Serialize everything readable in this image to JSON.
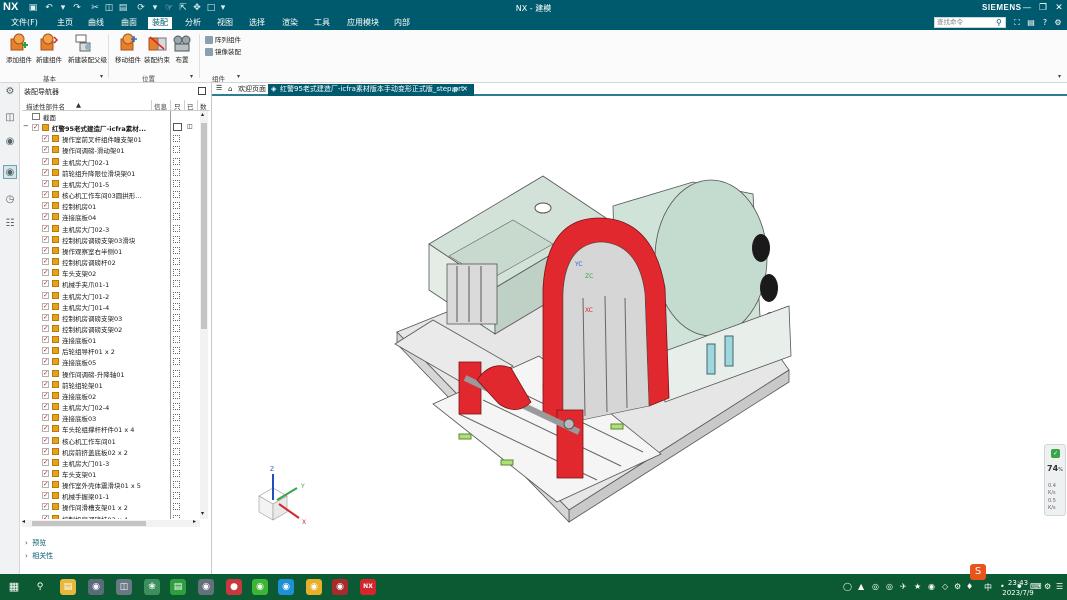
{
  "window": {
    "logo": "NX",
    "title": "NX - 建模",
    "brand": "SIEMENS"
  },
  "menu": {
    "items": [
      {
        "label": "文件(F)"
      },
      {
        "label": "主页"
      },
      {
        "label": "曲线"
      },
      {
        "label": "曲面"
      },
      {
        "label": "装配"
      },
      {
        "label": "分析"
      },
      {
        "label": "视图"
      },
      {
        "label": "选择"
      },
      {
        "label": "渲染"
      },
      {
        "label": "工具"
      },
      {
        "label": "应用模块"
      },
      {
        "label": "内部"
      }
    ],
    "active_index": 4,
    "search_placeholder": "查找命令"
  },
  "ribbon": {
    "buttons": [
      {
        "label": "添加组件"
      },
      {
        "label": "新建组件"
      },
      {
        "label": "新建装配父级"
      },
      {
        "label": "移动组件"
      },
      {
        "label": "装配约束"
      },
      {
        "label": "布置"
      }
    ],
    "small_buttons": [
      {
        "label": "阵列组件"
      },
      {
        "label": "镜像装配"
      }
    ],
    "groups": [
      {
        "label": "基本"
      },
      {
        "label": "位置"
      },
      {
        "label": "组件"
      }
    ]
  },
  "navigator": {
    "title": "装配导航器",
    "columns": {
      "name": "描述性部件名",
      "info": "信息",
      "c3": "只",
      "c4": "已",
      "c5": "数"
    },
    "section_row": "截面",
    "root": "红警95老式建造厂-icfra素材...",
    "items": [
      "操作室前叉杆组件瞳支架01",
      "操作间调磅-滑动架01",
      "主机房大门02-1",
      "前轮组升降限位滑块架01",
      "主机房大门01-5",
      "核心机工作车间03圆拱形...",
      "控制机房01",
      "连接底板04",
      "主机房大门02-3",
      "控制机房调磅支架03滑块",
      "操作观察室右半侧01",
      "控制机房调磅杆02",
      "车头支架02",
      "机械手夹爪01-1",
      "主机房大门01-2",
      "主机房大门01-4",
      "控制机房调磅支架03",
      "控制机房调磅支架02",
      "连接底板01",
      "后轮组导杆01 x 2",
      "连接底板05",
      "操作间调磅-升降轴01",
      "前轮组轮架01",
      "连接底板02",
      "主机房大门02-4",
      "连接底板03",
      "车头轮组撑杆杆件01 x 4",
      "核心机工作车间01",
      "机房前挤盖底板02 x 2",
      "主机房大门01-3",
      "车头支架01",
      "操作室外壳体震滑块01 x 5",
      "机械手握梁01-1",
      "操作间滑槽支架01 x 2",
      "控制机房调磅杆03 x 4"
    ],
    "panels": [
      {
        "label": "预览"
      },
      {
        "label": "相关性"
      }
    ]
  },
  "tabs": [
    {
      "label": "欢迎页面"
    },
    {
      "label": "红警95老式建造厂-icfra素材版本手动变形正式版_step.prt"
    }
  ],
  "tab_close": "✕",
  "viewport": {
    "axis_labels": {
      "z": "Z",
      "y": "Y",
      "x": "X"
    },
    "model_labels": {
      "yc": "YC",
      "zc": "ZC",
      "xc": "XC"
    }
  },
  "widget": {
    "cpu": "74",
    "cpu_unit": "%",
    "line1": "0.4",
    "line1_unit": "K/s",
    "line2": "0.5",
    "line2_unit": "K/s"
  },
  "taskbar": {
    "time": "23:43",
    "date": "2023/7/9",
    "ime": "中"
  },
  "colors": {
    "title_bg": "#005a6e",
    "taskbar_bg": "#0b5a33",
    "model_red": "#e0282e",
    "model_green_body": "#cfe3d8",
    "model_plate": "#f0f0f0"
  }
}
